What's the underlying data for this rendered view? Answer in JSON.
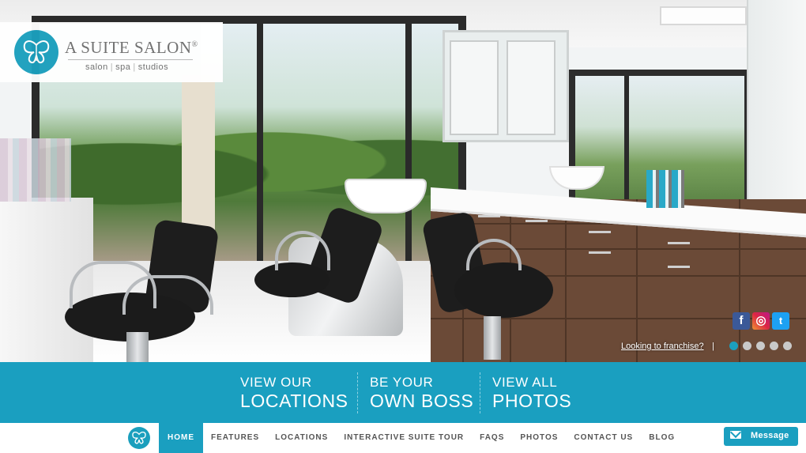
{
  "brand": {
    "name": "A SUITE SALON",
    "registered": "®",
    "tagline_parts": [
      "salon",
      "spa",
      "studios"
    ],
    "tagline_separator": "|",
    "accent_color": "#1a9fc0"
  },
  "hero": {
    "image_alt_icon": "salon-interior-photo",
    "social": [
      {
        "name": "facebook-icon",
        "glyph": "f"
      },
      {
        "name": "instagram-icon",
        "glyph": "◎"
      },
      {
        "name": "twitter-icon",
        "glyph": "t"
      }
    ],
    "franchise_link": "Looking to franchise?",
    "franchise_separator": "|",
    "slides": {
      "count": 5,
      "active": 1
    }
  },
  "cta": [
    {
      "line1": "VIEW OUR",
      "line2": "LOCATIONS"
    },
    {
      "line1": "BE YOUR",
      "line2": "OWN BOSS"
    },
    {
      "line1": "VIEW ALL",
      "line2": "PHOTOS"
    }
  ],
  "nav": {
    "logo_icon": "butterfly-icon",
    "items": [
      {
        "label": "HOME",
        "active": true
      },
      {
        "label": "FEATURES",
        "active": false
      },
      {
        "label": "LOCATIONS",
        "active": false
      },
      {
        "label": "INTERACTIVE SUITE TOUR",
        "active": false
      },
      {
        "label": "FAQS",
        "active": false
      },
      {
        "label": "PHOTOS",
        "active": false
      },
      {
        "label": "CONTACT US",
        "active": false
      },
      {
        "label": "BLOG",
        "active": false
      }
    ]
  },
  "message_button": {
    "label": "Message",
    "icon": "envelope-icon"
  }
}
